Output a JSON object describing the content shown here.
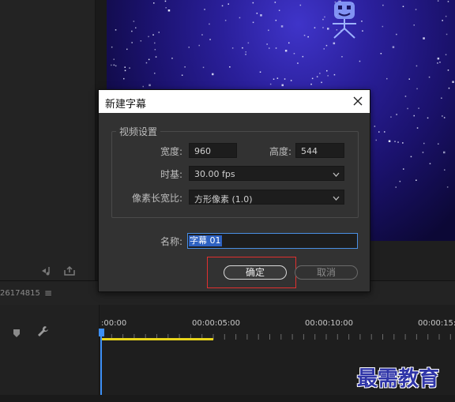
{
  "dialog": {
    "title": "新建字幕",
    "group_label": "视频设置",
    "width_label": "宽度:",
    "width_value": "960",
    "height_label": "高度:",
    "height_value": "544",
    "timebase_label": "时基:",
    "timebase_value": "30.00 fps",
    "pixel_aspect_label": "像素长宽比:",
    "pixel_aspect_value": "方形像素 (1.0)",
    "name_label": "名称:",
    "name_value": "字幕 01",
    "ok_label": "确定",
    "cancel_label": "取消"
  },
  "sequence": {
    "timecode": "26174815",
    "menu_glyph": "≡"
  },
  "timeline": {
    "ruler_labels": [
      ":00:00",
      "00:00:05:00",
      "00:00:10:00",
      "00:00:15:"
    ]
  },
  "watermark": "最需教育",
  "colors": {
    "accent_blue": "#3d8ff5",
    "work_area_yellow": "#e8d41c",
    "highlight_red": "#e0302f",
    "watermark_blue": "#2f35a8"
  }
}
